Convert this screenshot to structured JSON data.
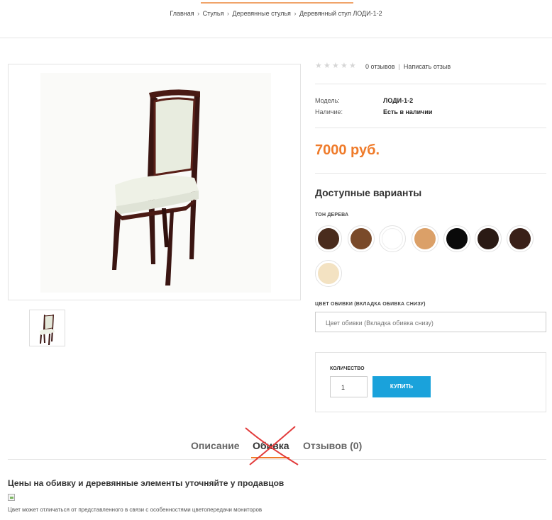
{
  "breadcrumb": {
    "items": [
      "Главная",
      "Стулья",
      "Деревянные стулья",
      "Деревянный стул ЛОДИ-1-2"
    ],
    "separator": "›"
  },
  "rating": {
    "stars": 0,
    "max_stars": 5,
    "reviews_link": "0 отзывов",
    "divider": "|",
    "write_review_link": "Написать отзыв"
  },
  "specs": {
    "model_label": "Модель:",
    "model_value": "ЛОДИ-1-2",
    "availability_label": "Наличие:",
    "availability_value": "Есть в наличии"
  },
  "price": "7000 руб.",
  "options": {
    "title": "Доступные варианты",
    "wood_tone_label": "ТОН ДЕРЕВА",
    "wood_tone_swatches": [
      {
        "name": "dark-walnut",
        "color": "#4a2c1d"
      },
      {
        "name": "walnut",
        "color": "#7a4a2a"
      },
      {
        "name": "white",
        "color": "#ffffff"
      },
      {
        "name": "light-oak",
        "color": "#dba068"
      },
      {
        "name": "black",
        "color": "#0a0a0a"
      },
      {
        "name": "wenge",
        "color": "#2a1a14"
      },
      {
        "name": "dark-brown",
        "color": "#3a2018"
      },
      {
        "name": "bleached-oak",
        "color": "#f3e2c2"
      }
    ],
    "upholstery_label": "ЦВЕТ ОБИВКИ (ВКЛАДКА ОБИВКА СНИЗУ)",
    "upholstery_placeholder": "Цвет обивки (Вкладка обивка снизу)"
  },
  "purchase": {
    "qty_label": "КОЛИЧЕСТВО",
    "qty_value": "1",
    "buy_label": "КУПИТЬ"
  },
  "tabs": [
    {
      "label": "Описание",
      "active": false
    },
    {
      "label": "Обивка",
      "active": true
    },
    {
      "label": "Отзывов (0)",
      "active": false
    }
  ],
  "content": {
    "title": "Цены на обивку и деревянные элементы уточняйте у продавцов",
    "note": "Цвет может отличаться от представленного в связи с особенностями цветопередачи мониторов"
  },
  "colors": {
    "accent": "#ef7b2a",
    "button": "#1aa2db",
    "annotation_cross": "#e23b3b"
  }
}
